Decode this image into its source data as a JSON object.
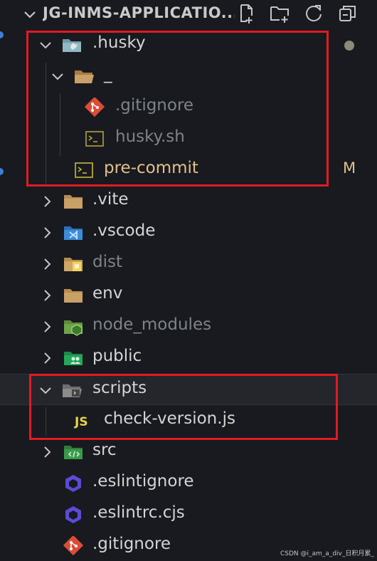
{
  "explorer": {
    "title": "JG-INMS-APPLICATIO...",
    "actions": [
      "new-file-icon",
      "new-folder-icon",
      "refresh-icon",
      "collapse-all-icon"
    ]
  },
  "tree": {
    "husky": ".husky",
    "underscore": "_",
    "gitignore_inner": ".gitignore",
    "husky_sh": "husky.sh",
    "pre_commit": "pre-commit",
    "pre_commit_badge": "M",
    "vite": ".vite",
    "vscode": ".vscode",
    "dist": "dist",
    "env": "env",
    "node_modules": "node_modules",
    "public": "public",
    "scripts": "scripts",
    "check_version": "check-version.js",
    "src": "src",
    "eslintignore": ".eslintignore",
    "eslintrc": ".eslintrc.cjs",
    "gitignore": ".gitignore"
  },
  "colors": {
    "background": "#181a1f",
    "modified": "#e2c08d",
    "highlight": "#e11b22",
    "folder": "#c09553"
  },
  "watermark": "CSDN @i_am_a_div_日积月累_"
}
